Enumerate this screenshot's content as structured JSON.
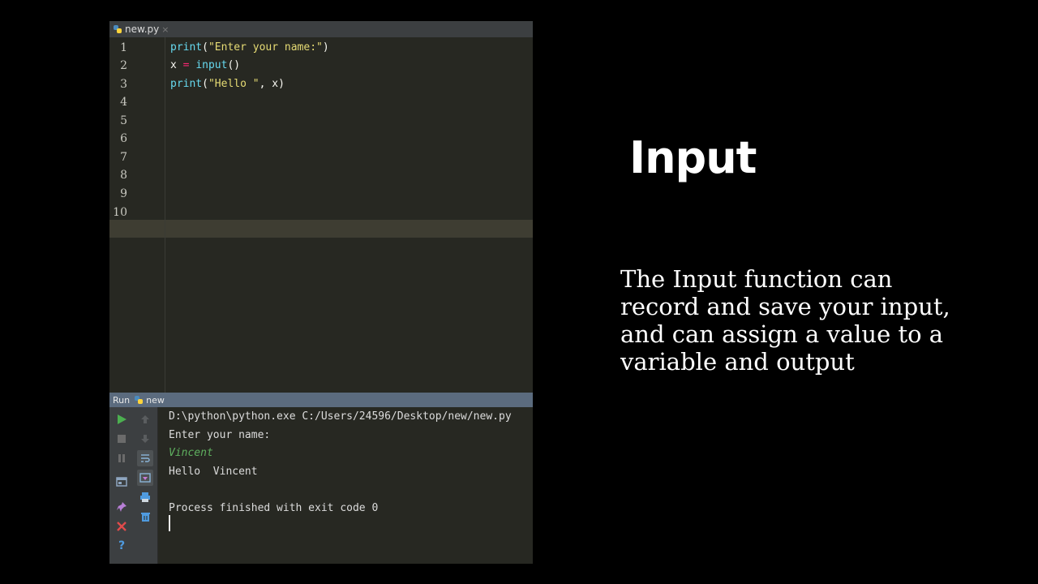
{
  "editor": {
    "tab": {
      "filename": "new.py",
      "close": "×"
    },
    "line_numbers": [
      "1",
      "2",
      "3",
      "4",
      "5",
      "6",
      "7",
      "8",
      "9",
      "10"
    ],
    "lines": [
      {
        "fn": "print",
        "open": "(",
        "string": "\"Enter your name:\"",
        "close": ")"
      },
      {
        "var": "x",
        "eq": " = ",
        "fn": "input",
        "parens": "()"
      },
      {
        "fn": "print",
        "open": "(",
        "string": "\"Hello \"",
        "rest": ", x)"
      }
    ]
  },
  "run_panel": {
    "label": "Run",
    "config_name": "new",
    "console": {
      "command": "D:\\python\\python.exe C:/Users/24596/Desktop/new/new.py",
      "prompt": "Enter your name:",
      "user_input": "Vincent",
      "output": "Hello  Vincent",
      "exit": "Process finished with exit code 0"
    },
    "toolbar_icons": {
      "run": "run-icon",
      "stop": "stop-icon",
      "pause": "pause-icon",
      "layout": "layout-icon",
      "pin": "pin-icon",
      "close": "close-icon",
      "help": "help-icon",
      "up": "up-arrow-icon",
      "down": "down-arrow-icon",
      "wrap": "soft-wrap-icon",
      "scroll": "scroll-to-end-icon",
      "print": "print-icon",
      "trash": "trash-icon"
    }
  },
  "slide": {
    "title": "Input",
    "description": "The Input function can record and save your input, and can assign a value to a variable and output"
  },
  "colors": {
    "editor_bg": "#272822",
    "keyword": "#66d9ef",
    "string": "#e6db74",
    "operator": "#f92672",
    "user_input": "#5fb05f",
    "run_header": "#5b6b7e"
  }
}
